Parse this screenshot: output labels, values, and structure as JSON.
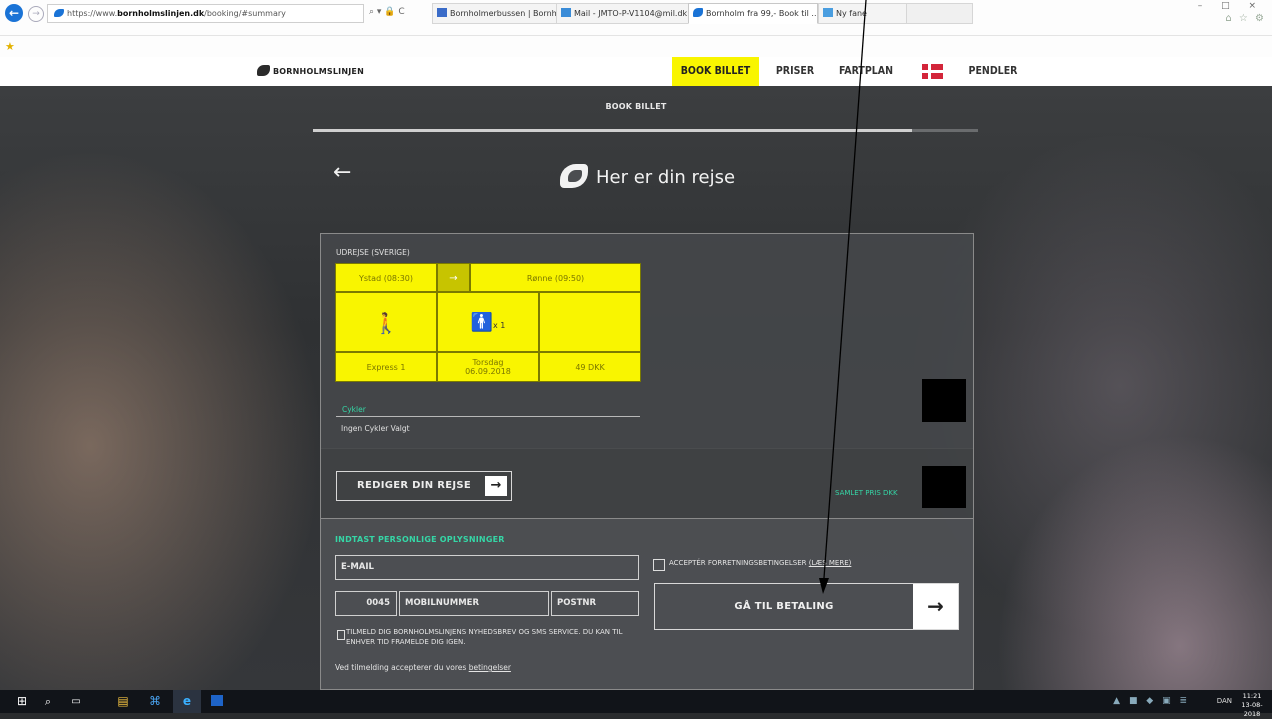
{
  "browser": {
    "url_prefix": "https://www.",
    "url_domain": "bornholmslinjen.dk",
    "url_path": "/booking/#summary",
    "url_controls": "⌕ ▾ 🔒 C",
    "tabs": [
      {
        "label": "Bornholmerbussen | Bornholm...",
        "active": false
      },
      {
        "label": "Mail - JMTO-P-V1104@mil.dk",
        "active": false
      },
      {
        "label": "Bornholm fra 99,- Book til ...",
        "active": true,
        "close": "×"
      },
      {
        "label": "Ny fane",
        "active": false
      }
    ],
    "window_controls": "– □ ×",
    "toolbar_icons": "⌂ ☆ ⚙"
  },
  "site": {
    "logo_text": "BORNHOLMSLINJEN",
    "nav": {
      "book": "BOOK BILLET",
      "priser": "PRISER",
      "fartplan": "FARTPLAN",
      "pendler": "PENDLER"
    },
    "flag": "denmark-flag"
  },
  "page": {
    "step_title": "BOOK BILLET",
    "progress_fraction": 0.9,
    "back_arrow": "←",
    "heading": "Her er din rejse"
  },
  "trip": {
    "direction_label": "UDREJSE (SVERIGE)",
    "from": "Ystad (08:30)",
    "route_arrow": "→",
    "to": "Rønne (09:50)",
    "walker_icon": "🚶",
    "person_icon": "🚹",
    "person_count": "x 1",
    "ferry": "Express 1",
    "date_line1": "Torsdag",
    "date_line2": "06.09.2018",
    "price": "49 DKK",
    "bikes_label": "Cykler",
    "bikes_value": "Ingen Cykler Valgt"
  },
  "edit": {
    "edit_label": "REDIGER DIN REJSE",
    "edit_arrow": "→",
    "total_label": "SAMLET PRIS DKK"
  },
  "personal": {
    "heading": "INDTAST PERSONLIGE OPLYSNINGER",
    "email_placeholder": "E-MAIL",
    "phone_prefix": "0045",
    "mobile_placeholder": "MOBILNUMMER",
    "postnr_placeholder": "POSTNR",
    "newsletter_text": "TILMELD DIG BORNHOLMSLINJENS NYHEDSBREV OG SMS SERVICE. DU KAN TIL ENHVER TID FRAMELDE DIG IGEN.",
    "consent_text": "Ved tilmelding accepterer du vores ",
    "consent_link": "betingelser",
    "terms_text": "ACCEPTÉR FORRETNINGSBETINGELSER ",
    "terms_link": "(LÆS MERE)",
    "pay_label": "GÅ TIL BETALING",
    "pay_arrow": "→"
  },
  "taskbar": {
    "start_icon": "⊞",
    "search_icon": "⌕",
    "taskview_icon": "▭",
    "files_icon": "▤",
    "pinned_icon": "⌘",
    "ie_icon": "e",
    "tray_lang": "DAN",
    "tray_icons": "▲ ■ ◆ ▣ ≣",
    "time": "11:21",
    "date": "13-08-2018"
  },
  "colors": {
    "accent_yellow": "#f9f500",
    "accent_green": "#35d6a6",
    "flag_red": "#d3253a"
  }
}
